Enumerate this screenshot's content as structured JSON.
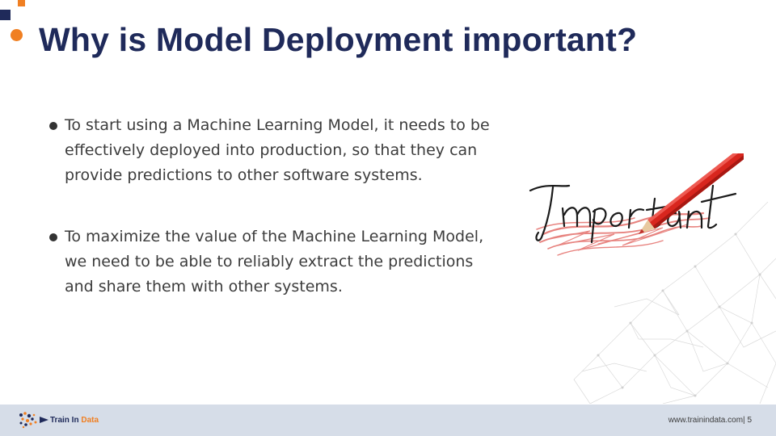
{
  "slide": {
    "title": "Why is Model Deployment important?",
    "bullets": [
      "To start using a Machine Learning Model, it needs to be effectively deployed into production, so that they can provide predictions to other software systems.",
      "To maximize the value of the Machine Learning Model, we need to be able to reliably extract the predictions and share them with other systems."
    ],
    "image": {
      "word": "Important"
    }
  },
  "footer": {
    "logo": {
      "word1": "Train In",
      "word2": "Data"
    },
    "website": "www.trainindata.com",
    "separator": "|",
    "page_number": "5"
  },
  "colors": {
    "title": "#1f2a5a",
    "accent_orange": "#f07f22",
    "footer_bg": "#d6dde8",
    "body_text": "#3c3c3c",
    "pencil_red": "#d8261e"
  }
}
